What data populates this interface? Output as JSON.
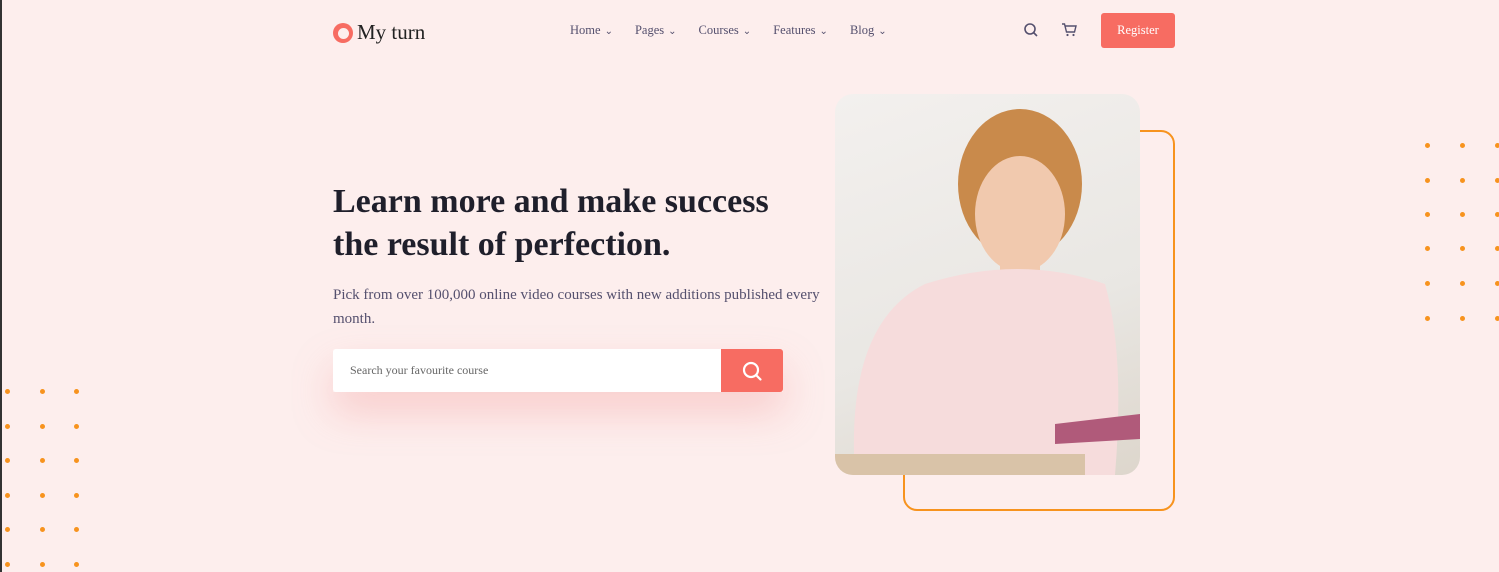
{
  "brand": {
    "name": "My turn",
    "color": "#f76c62"
  },
  "nav": {
    "items": [
      {
        "label": "Home"
      },
      {
        "label": "Pages"
      },
      {
        "label": "Courses"
      },
      {
        "label": "Features"
      },
      {
        "label": "Blog"
      }
    ]
  },
  "header": {
    "search_icon": "search-icon",
    "cart_icon": "cart-icon",
    "register_label": "Register"
  },
  "hero": {
    "title": "Learn more and make success the result of perfection.",
    "subtitle": "Pick from over 100,000 online video courses with new additions published every month.",
    "search_placeholder": "Search your favourite course"
  },
  "colors": {
    "accent": "#f76c62",
    "dots": "#f7931e",
    "background": "#fdeeed"
  }
}
